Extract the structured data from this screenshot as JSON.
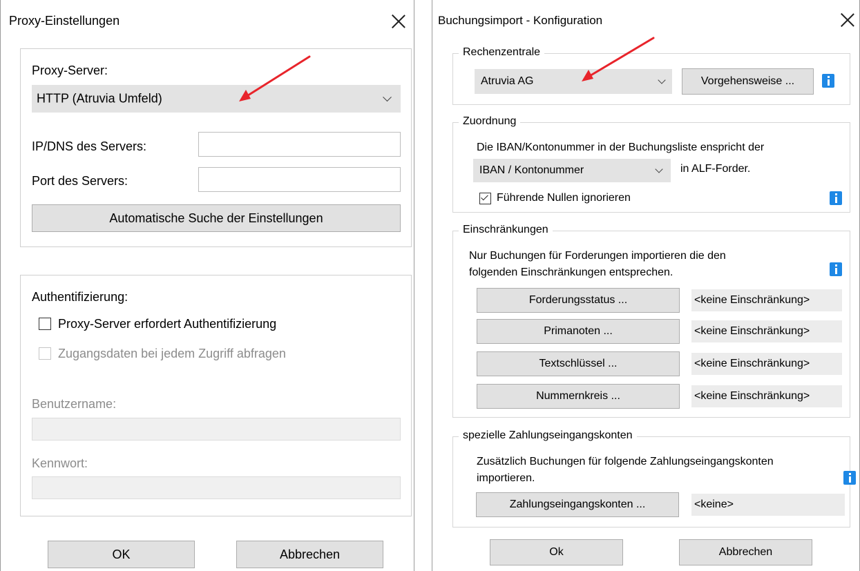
{
  "proxy_dialog": {
    "title": "Proxy-Einstellungen",
    "proxy_server_label": "Proxy-Server:",
    "proxy_server_value": "HTTP (Atruvia Umfeld)",
    "ip_label": "IP/DNS des Servers:",
    "ip_value": "",
    "port_label": "Port des Servers:",
    "port_value": "",
    "auto_search_button": "Automatische Suche der Einstellungen",
    "auth_label": "Authentifizierung:",
    "auth_checkbox_label": "Proxy-Server erfordert Authentifizierung",
    "auth_checkbox_checked": false,
    "prompt_checkbox_label": "Zugangsdaten bei jedem Zugriff abfragen",
    "prompt_checkbox_checked": false,
    "prompt_checkbox_enabled": false,
    "username_label": "Benutzername:",
    "username_value": "",
    "password_label": "Kennwort:",
    "password_value": "",
    "ok_button": "OK",
    "cancel_button": "Abbrechen"
  },
  "import_dialog": {
    "title": "Buchungsimport - Konfiguration",
    "rechenzentrale": {
      "legend": "Rechenzentrale",
      "value": "Atruvia AG",
      "procedure_button": "Vorgehensweise ..."
    },
    "zuordnung": {
      "legend": "Zuordnung",
      "description": "Die IBAN/Kontonummer in der Buchungsliste enspricht der",
      "select_value": "IBAN / Kontonummer",
      "suffix": "in ALF-Forder.",
      "leading_zeros_label": "Führende Nullen ignorieren",
      "leading_zeros_checked": true
    },
    "einschraenkungen": {
      "legend": "Einschränkungen",
      "description_line1": "Nur Buchungen für Forderungen importieren die den",
      "description_line2": "folgenden Einschränkungen entsprechen.",
      "rows": [
        {
          "button": "Forderungsstatus ...",
          "value": "<keine Einschränkung>"
        },
        {
          "button": "Primanoten ...",
          "value": "<keine Einschränkung>"
        },
        {
          "button": "Textschlüssel ...",
          "value": "<keine Einschränkung>"
        },
        {
          "button": "Nummernkreis ...",
          "value": "<keine Einschränkung>"
        }
      ]
    },
    "konten": {
      "legend": "spezielle Zahlungseingangskonten",
      "description_line1": "Zusätzlich Buchungen für folgende Zahlungseingangskonten",
      "description_line2": "importieren.",
      "button": "Zahlungseingangskonten ...",
      "value": "<keine>"
    },
    "ok_button": "Ok",
    "cancel_button": "Abbrechen"
  },
  "annotations": {
    "arrow_color": "#e8242b",
    "info_icon_color": "#1e88e5"
  }
}
